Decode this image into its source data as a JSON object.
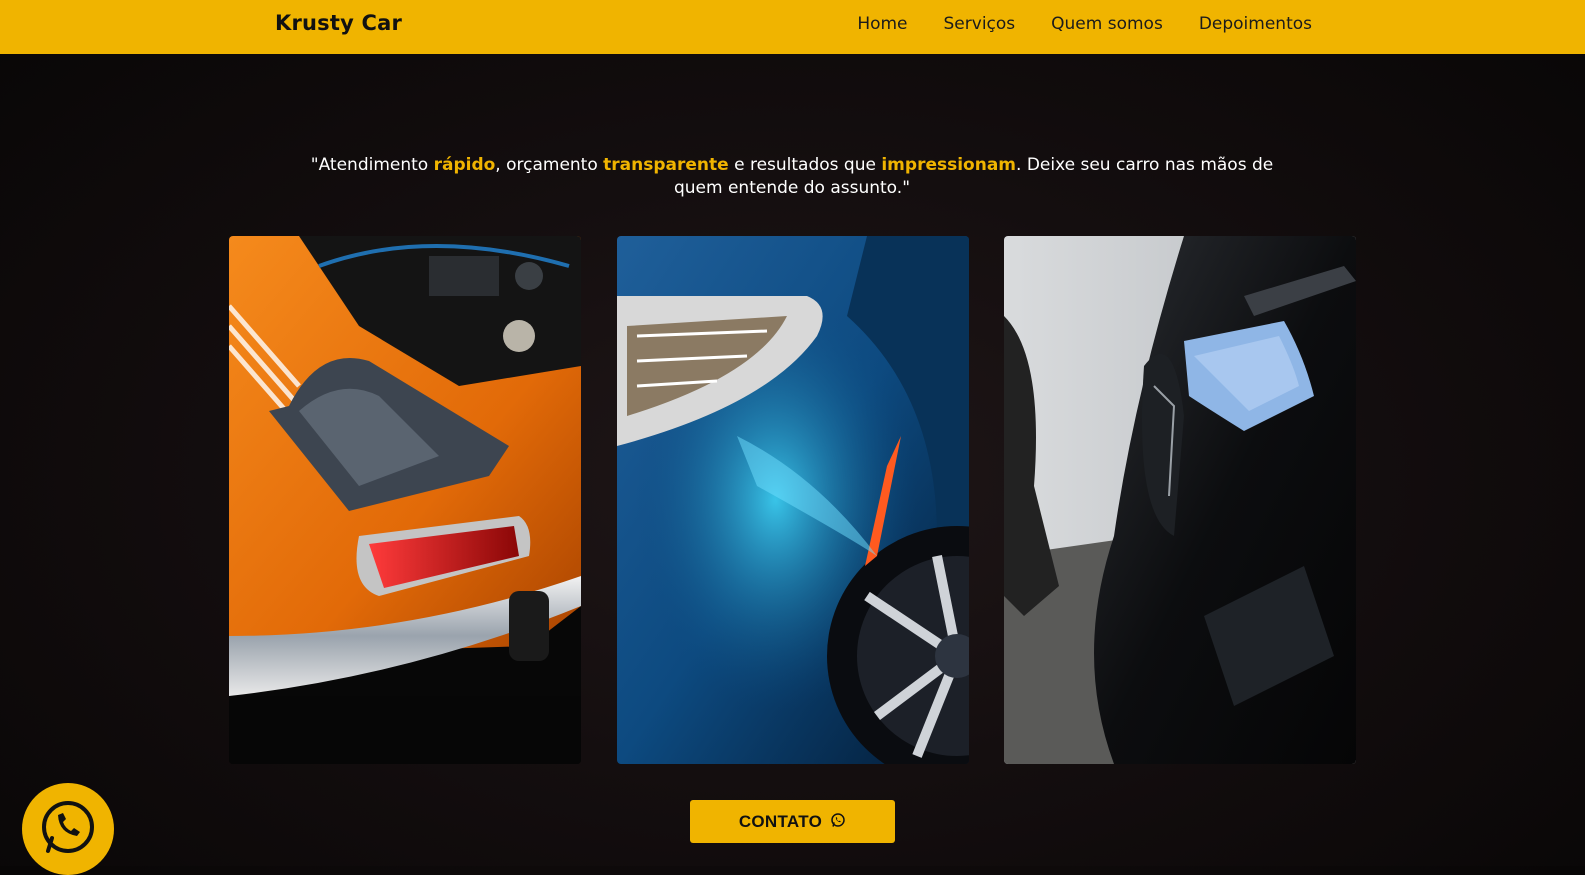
{
  "header": {
    "brand": "Krusty Car",
    "nav": [
      {
        "label": "Home"
      },
      {
        "label": "Serviços"
      },
      {
        "label": "Quem somos"
      },
      {
        "label": "Depoimentos"
      }
    ]
  },
  "hero": {
    "quote": {
      "part1": "\"Atendimento ",
      "hl1": "rápido",
      "part2": ", orçamento ",
      "hl2": "transparente",
      "part3": " e resultados que ",
      "hl3": "impressionam",
      "part4": ". Deixe seu carro nas mãos de quem entende do assunto.\""
    }
  },
  "gallery": {
    "images": [
      {
        "subject": "orange classic car rear with tail light"
      },
      {
        "subject": "blue car headlight and wheel"
      },
      {
        "subject": "black car being polished with blue cloth"
      }
    ]
  },
  "contact": {
    "label": "CONTATO",
    "icon": "whatsapp-icon"
  },
  "floating_button": {
    "icon": "whatsapp-icon"
  },
  "colors": {
    "accent": "#f0b400",
    "background": "#140e0f",
    "text": "#ffffff"
  }
}
